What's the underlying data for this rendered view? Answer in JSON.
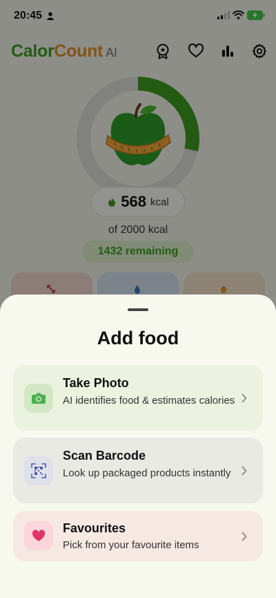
{
  "status_bar": {
    "time": "20:45"
  },
  "header": {
    "logo_part1": "Calor",
    "logo_part2": "Count",
    "logo_part3": "AI",
    "icons": [
      "award-icon",
      "heart-icon",
      "bar-chart-icon",
      "gear-icon"
    ]
  },
  "summary": {
    "consumed": 568,
    "consumed_text": "568",
    "unit": "kcal",
    "goal_text": "of 2000 kcal",
    "goal": 2000,
    "remaining_text": "1432 remaining",
    "progress_fraction": 0.284
  },
  "colors": {
    "brand_green": "#3e9e22",
    "brand_orange": "#e0932a",
    "photo_bg": "#ebf2e0",
    "barcode_bg": "#e8eae3",
    "fav_bg": "#f6e8e2"
  },
  "sheet": {
    "title": "Add food",
    "options": [
      {
        "icon": "camera-icon",
        "title": "Take Photo",
        "description": "AI identifies food & estimates calories"
      },
      {
        "icon": "barcode-scan-icon",
        "title": "Scan Barcode",
        "description": "Look up packaged products instantly"
      },
      {
        "icon": "heart-icon",
        "title": "Favourites",
        "description": "Pick from your favourite items"
      }
    ]
  }
}
